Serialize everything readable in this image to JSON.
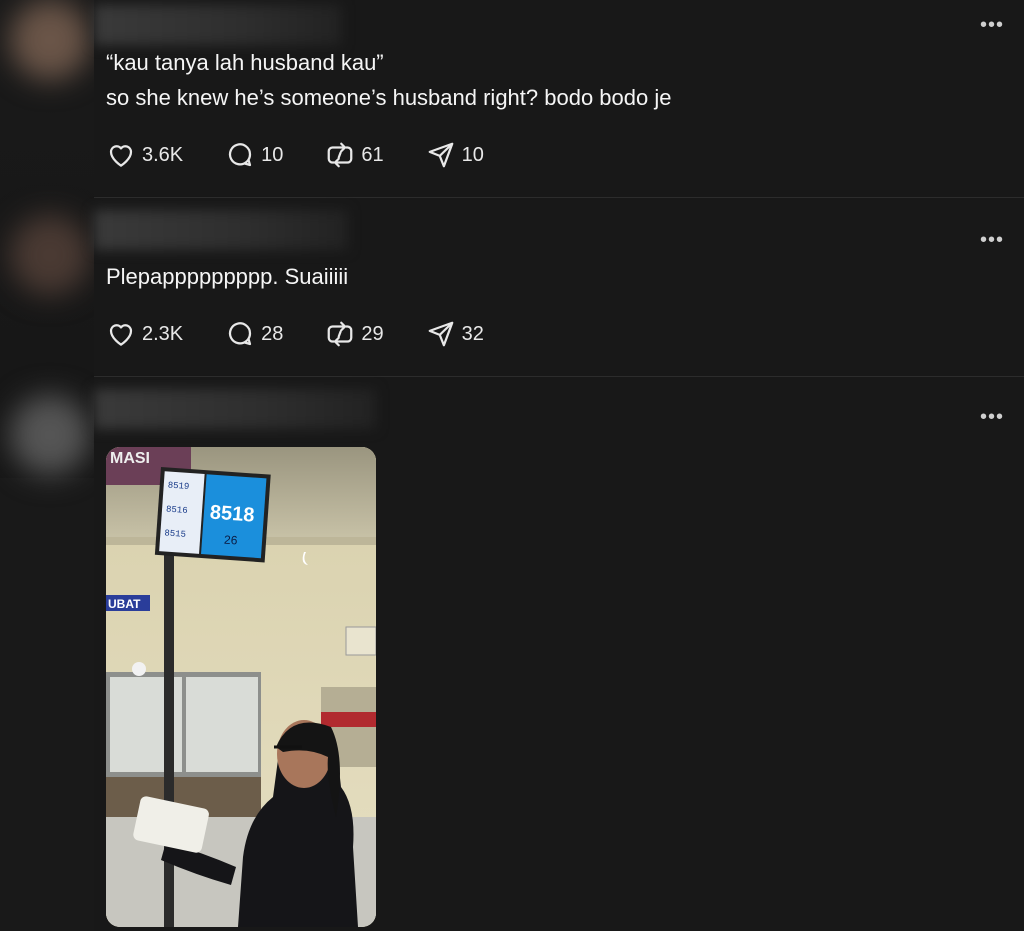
{
  "posts": [
    {
      "text_lines": [
        "“kau tanya lah husband kau”",
        "so she knew he’s someone’s husband right? bodo bodo je"
      ],
      "likes": "3.6K",
      "replies": "10",
      "reposts": "61",
      "shares": "10"
    },
    {
      "text_lines": [
        "Plepappppppppp. Suaiiiii"
      ],
      "likes": "2.3K",
      "replies": "28",
      "reposts": "29",
      "shares": "32"
    }
  ],
  "media": {
    "monitor_numbers": [
      "8519",
      "8516",
      "8515"
    ],
    "monitor_current": "8518",
    "monitor_counter": "26",
    "sign_top": "MASI",
    "sign_ubat": "UBAT"
  },
  "icons": {
    "like": "heart-icon",
    "reply": "comment-icon",
    "repost": "repost-icon",
    "share": "share-icon",
    "more": "more-icon"
  }
}
